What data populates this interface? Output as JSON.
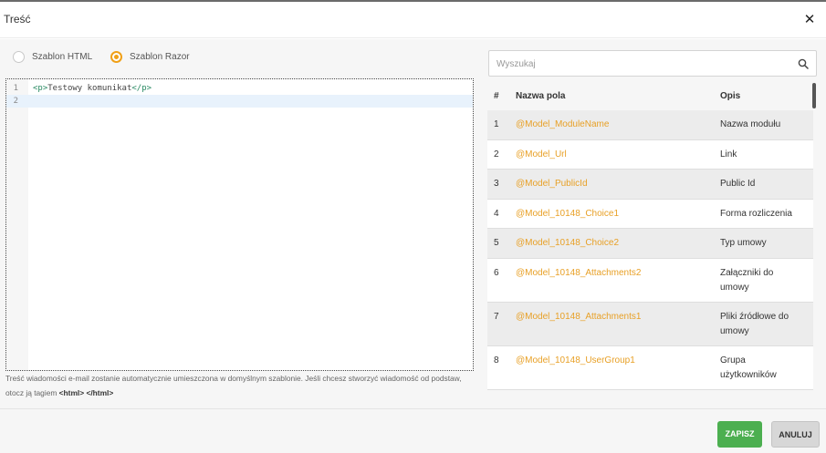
{
  "dialog": {
    "title": "Treść",
    "close_icon": "close-icon"
  },
  "template_options": {
    "html_label": "Szablon HTML",
    "razor_label": "Szablon Razor",
    "selected": "razor"
  },
  "editor": {
    "lines": [
      {
        "number": "1",
        "tag_open": "<p>",
        "text": "Testowy komunikat",
        "tag_close": "</p>"
      },
      {
        "number": "2",
        "tag_open": "",
        "text": "",
        "tag_close": ""
      }
    ]
  },
  "hint": {
    "text": "Treść wiadomości e-mail zostanie automatycznie umieszczona w domyślnym szablonie. Jeśli chcesz stworzyć wiadomość od podstaw, otocz ją tagiem",
    "tags": "<html> </html>"
  },
  "search": {
    "placeholder": "Wyszukaj",
    "value": "",
    "icon": "search-icon"
  },
  "fields_table": {
    "headers": {
      "num": "#",
      "name": "Nazwa pola",
      "desc": "Opis"
    },
    "rows": [
      {
        "num": "1",
        "name": "@Model_ModuleName",
        "desc": "Nazwa modułu"
      },
      {
        "num": "2",
        "name": "@Model_Url",
        "desc": "Link"
      },
      {
        "num": "3",
        "name": "@Model_PublicId",
        "desc": "Public Id"
      },
      {
        "num": "4",
        "name": "@Model_10148_Choice1",
        "desc": "Forma rozliczenia"
      },
      {
        "num": "5",
        "name": "@Model_10148_Choice2",
        "desc": "Typ umowy"
      },
      {
        "num": "6",
        "name": "@Model_10148_Attachments2",
        "desc": "Załączniki do umowy"
      },
      {
        "num": "7",
        "name": "@Model_10148_Attachments1",
        "desc": "Pliki źródłowe do umowy"
      },
      {
        "num": "8",
        "name": "@Model_10148_UserGroup1",
        "desc": "Grupa użytkowników"
      }
    ]
  },
  "buttons": {
    "save": "ZAPISZ",
    "cancel": "ANULUJ"
  },
  "colors": {
    "accent": "#f0a017",
    "field_name": "#e8a026",
    "save_button": "#4caf50",
    "cancel_button": "#d7d7d7"
  }
}
